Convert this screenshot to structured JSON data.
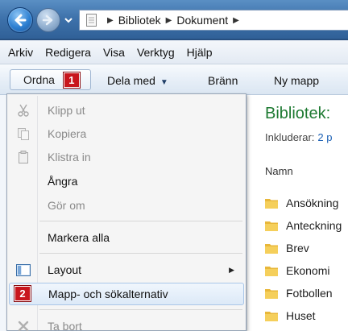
{
  "address": {
    "crumbs": [
      "Bibliotek",
      "Dokument"
    ]
  },
  "menubar": {
    "items": [
      "Arkiv",
      "Redigera",
      "Visa",
      "Verktyg",
      "Hjälp"
    ]
  },
  "toolbar": {
    "organize_label": "Ordna",
    "organize_badge": "1",
    "share_label": "Dela med",
    "burn_label": "Bränn",
    "new_folder_label": "Ny mapp"
  },
  "menu": {
    "cut": "Klipp ut",
    "copy": "Kopiera",
    "paste": "Klistra in",
    "undo": "Ångra",
    "redo": "Gör om",
    "select_all": "Markera alla",
    "layout": "Layout",
    "folder_options": "Mapp- och sökalternativ",
    "folder_options_badge": "2",
    "delete": "Ta bort"
  },
  "right_pane": {
    "title": "Bibliotek:",
    "include_label": "Inkluderar:",
    "include_link": "2 p",
    "column_name": "Namn",
    "folders": [
      "Ansökning",
      "Anteckning",
      "Brev",
      "Ekonomi",
      "Fotbollen",
      "Huset"
    ]
  },
  "colors": {
    "title_green": "#1e7a32",
    "badge_red": "#c8161d",
    "link_blue": "#1a5fb4"
  }
}
